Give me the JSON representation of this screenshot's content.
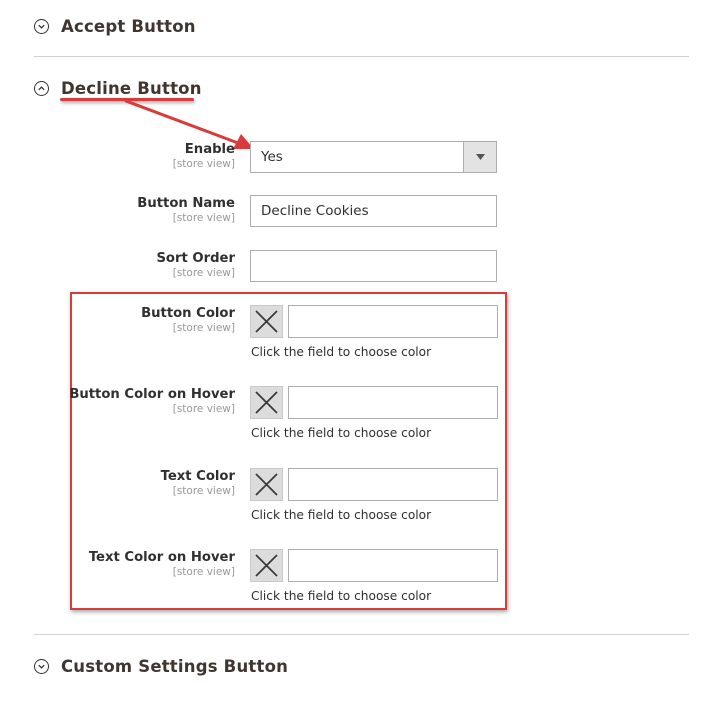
{
  "sections": {
    "accept": {
      "title": "Accept Button",
      "collapsed": true
    },
    "decline": {
      "title": "Decline Button",
      "collapsed": false
    },
    "custom": {
      "title": "Custom Settings Button",
      "collapsed": true
    }
  },
  "scope_label": "[store view]",
  "fields": {
    "enable": {
      "label": "Enable",
      "scope": "[store view]",
      "value": "Yes",
      "options": [
        "Yes"
      ]
    },
    "button_name": {
      "label": "Button Name",
      "scope": "[store view]",
      "value": "Decline Cookies"
    },
    "sort_order": {
      "label": "Sort Order",
      "scope": "[store view]",
      "value": ""
    }
  },
  "color_fields": [
    {
      "label": "Button Color",
      "scope": "[store view]",
      "value": "",
      "note": "Click the field to choose color",
      "swatch_icon": "no-color-x-icon"
    },
    {
      "label": "Button Color on Hover",
      "scope": "[store view]",
      "value": "",
      "note": "Click the field to choose color",
      "swatch_icon": "no-color-x-icon"
    },
    {
      "label": "Text Color",
      "scope": "[store view]",
      "value": "",
      "note": "Click the field to choose color",
      "swatch_icon": "no-color-x-icon"
    },
    {
      "label": "Text Color on Hover",
      "scope": "[store view]",
      "value": "",
      "note": "Click the field to choose color",
      "swatch_icon": "no-color-x-icon"
    }
  ],
  "annotation_color": "#d93a3a"
}
